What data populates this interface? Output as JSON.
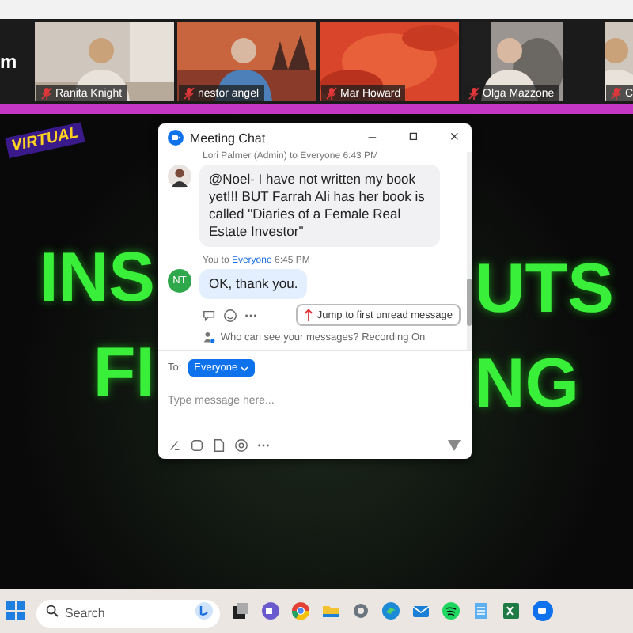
{
  "gallery": {
    "cut_label": "m",
    "participants": [
      {
        "name": "Ranita Knight",
        "muted": true
      },
      {
        "name": "nestor angel",
        "muted": true
      },
      {
        "name": "Mar Howard",
        "muted": true
      },
      {
        "name": "Olga Mazzone",
        "muted": true
      },
      {
        "name": "C",
        "muted": true
      }
    ]
  },
  "slide": {
    "badge": "VIRTUAL",
    "left_words": [
      "INS",
      "FI"
    ],
    "right_words": [
      "UTS",
      "NG"
    ]
  },
  "chat": {
    "title": "Meeting Chat",
    "messages": [
      {
        "kind": "incoming",
        "header": "Lori Palmer (Admin) to Everyone 6:43 PM",
        "text": "@Noel- I have not written my book yet!!! BUT Farrah Ali has her book is called \"Diaries of a Female Real Estate Investor\""
      },
      {
        "kind": "outgoing",
        "header_from": "You to",
        "header_to": "Everyone",
        "time": "6:45 PM",
        "initials": "NT",
        "text": "OK, thank you."
      }
    ],
    "jump_button": "Jump to first unread message",
    "privacy_note": "Who can see your messages? Recording On",
    "to_label": "To:",
    "recipient": "Everyone",
    "input": {
      "placeholder": "Type message here..."
    }
  },
  "taskbar": {
    "search": {
      "placeholder": "Search"
    }
  }
}
